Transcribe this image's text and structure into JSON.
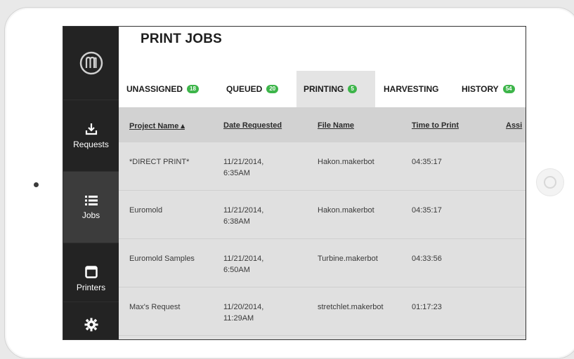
{
  "sidebar": {
    "items": [
      {
        "label": "Requests",
        "icon": "download-icon"
      },
      {
        "label": "Jobs",
        "icon": "list-icon"
      },
      {
        "label": "Printers",
        "icon": "printer-icon"
      },
      {
        "label": "",
        "icon": "gear-icon"
      }
    ]
  },
  "page": {
    "title": "PRINT JOBS"
  },
  "tabs": [
    {
      "label": "UNASSIGNED",
      "count": "18"
    },
    {
      "label": "QUEUED",
      "count": "20"
    },
    {
      "label": "PRINTING",
      "count": "5"
    },
    {
      "label": "HARVESTING",
      "count": ""
    },
    {
      "label": "HISTORY",
      "count": "54"
    }
  ],
  "table": {
    "headers": {
      "project": "Project Name ▴",
      "date": "Date Requested",
      "file": "File Name",
      "time": "Time to Print",
      "assigned": "Assi"
    },
    "rows": [
      {
        "project": "*DIRECT PRINT*",
        "date1": "11/21/2014,",
        "date2": "6:35AM",
        "file": "Hakon.makerbot",
        "time": "04:35:17"
      },
      {
        "project": "Euromold",
        "date1": "11/21/2014,",
        "date2": "6:38AM",
        "file": "Hakon.makerbot",
        "time": "04:35:17"
      },
      {
        "project": "Euromold Samples",
        "date1": "11/21/2014,",
        "date2": "6:50AM",
        "file": "Turbine.makerbot",
        "time": "04:33:56"
      },
      {
        "project": "Max's Request",
        "date1": "11/20/2014,",
        "date2": "11:29AM",
        "file": "stretchlet.makerbot",
        "time": "01:17:23"
      }
    ]
  },
  "colors": {
    "accent_green": "#3db54a",
    "sidebar": "#232323"
  }
}
